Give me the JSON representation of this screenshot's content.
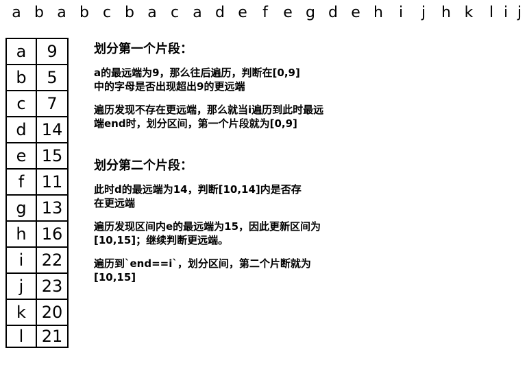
{
  "sequence": [
    "a",
    "b",
    "a",
    "b",
    "c",
    "b",
    "a",
    "c",
    "a",
    "d",
    "e",
    "f",
    "e",
    "g",
    "d",
    "e",
    "h",
    "i",
    "j",
    "h",
    "k",
    "l",
    "i",
    "j"
  ],
  "last_index_table": [
    {
      "char": "a",
      "last": "9"
    },
    {
      "char": "b",
      "last": "5"
    },
    {
      "char": "c",
      "last": "7"
    },
    {
      "char": "d",
      "last": "14"
    },
    {
      "char": "e",
      "last": "15"
    },
    {
      "char": "f",
      "last": "11"
    },
    {
      "char": "g",
      "last": "13"
    },
    {
      "char": "h",
      "last": "16"
    },
    {
      "char": "i",
      "last": "22"
    },
    {
      "char": "j",
      "last": "23"
    },
    {
      "char": "k",
      "last": "20"
    },
    {
      "char": "l",
      "last": "21"
    }
  ],
  "notes": {
    "heading1": "划分第一个片段：",
    "p1_line1": "a的最远端为9，那么往后遍历，判断在[0,9]",
    "p1_line2": "中的字母是否出现超出9的更远端",
    "p2_line1": "遍历发现不存在更远端，那么就当i遍历到此时最远",
    "p2_line2": "端end时，划分区间，第一个片段就为[0,9]",
    "heading2": "划分第二个片段：",
    "p3_line1": "此时d的最远端为14，判断[10,14]内是否存",
    "p3_line2": "在更远端",
    "p4_line1": "遍历发现区间内e的最远端为15，因此更新区间为",
    "p4_line2": "[10,15]；继续判断更远端。",
    "p5_line1": "遍历到`end==i`，划分区间，第二个片断就为",
    "p5_line2": "[10,15]"
  }
}
